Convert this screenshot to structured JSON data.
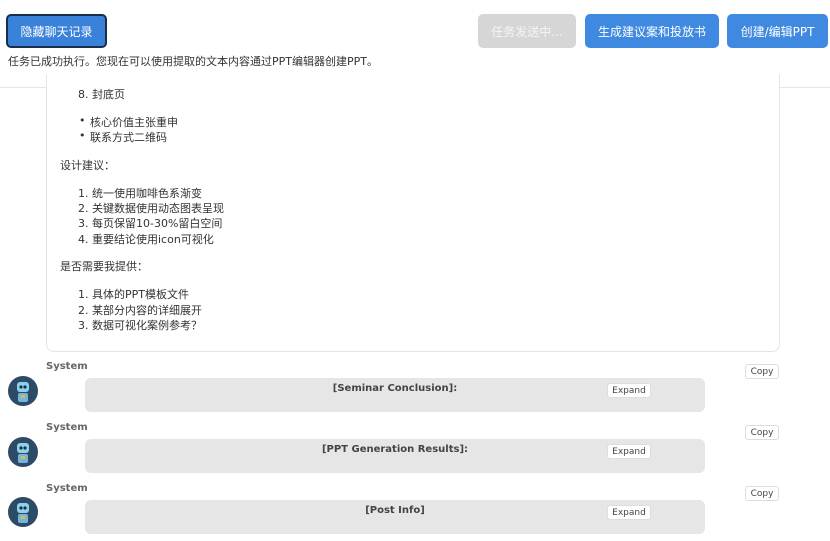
{
  "header": {
    "hide_chat_label": "隐藏聊天记录",
    "sending_label": "任务发送中...",
    "proposal_label": "生成建议案和投放书",
    "ppt_label": "创建/编辑PPT",
    "status_text": "任务已成功执行。您现在可以使用提取的文本内容通过PPT编辑器创建PPT。"
  },
  "content": {
    "item8": "8. 封底页",
    "bullets": [
      "核心价值主张重申",
      "联系方式二维码"
    ],
    "design_heading": "设计建议：",
    "design_items": [
      "1. 统一使用咖啡色系渐变",
      "2. 关键数据使用动态图表呈现",
      "3. 每页保留10-30%留白空间",
      "4. 重要结论使用icon可视化"
    ],
    "provide_heading": "是否需要我提供：",
    "provide_items": [
      "1. 具体的PPT模板文件",
      "2. 某部分内容的详细展开",
      "3. 数据可视化案例参考？"
    ]
  },
  "messages": [
    {
      "sender": "System",
      "title": "[Seminar Conclusion]:",
      "expand_label": "Expand",
      "copy_label": "Copy"
    },
    {
      "sender": "System",
      "title": "[PPT Generation Results]:",
      "expand_label": "Expand",
      "copy_label": "Copy"
    },
    {
      "sender": "System",
      "title": "[Post Info]",
      "expand_label": "Expand",
      "copy_label": "Copy"
    }
  ],
  "colors": {
    "primary": "#3f8ae0",
    "disabled": "#d6d6d6",
    "message_bg": "#e6e6e6"
  },
  "icons": {
    "avatar": "robot-avatar-icon"
  }
}
